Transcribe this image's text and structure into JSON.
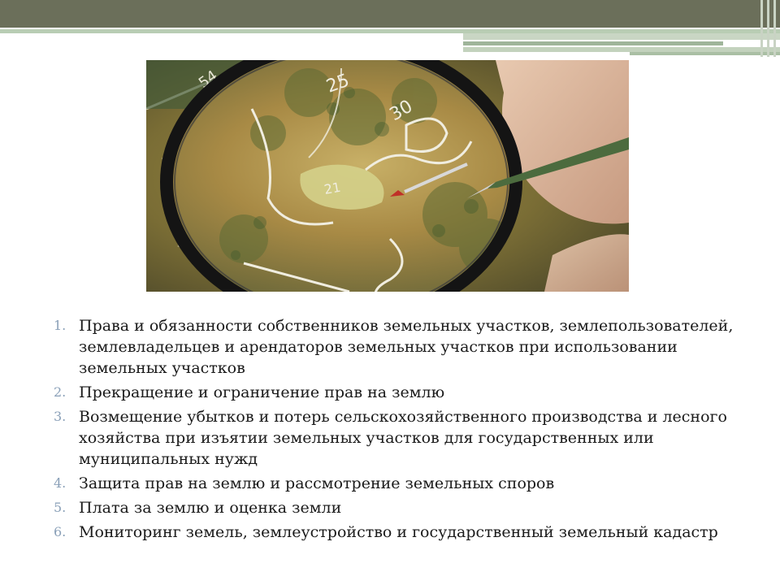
{
  "slide": {
    "image_alt": "magnifying-glass-over-land-map",
    "items": [
      {
        "num": "1.",
        "text": "Права и обязанности собственников земельных участков, землепользователей, землевладельцев и арендаторов земельных участков при использовании земельных участков"
      },
      {
        "num": "2.",
        "text": "Прекращение и ограничение прав на землю"
      },
      {
        "num": "3.",
        "text": "Возмещение убытков и потерь сельскохозяйственного производства и лесного хозяйства при изъятии земельных участков для государственных или муниципальных нужд"
      },
      {
        "num": "4.",
        "text": "Защита прав на землю и рассмотрение земельных споров"
      },
      {
        "num": "5.",
        "text": "Плата за землю и оценка земли"
      },
      {
        "num": "6.",
        "text": "Мониторинг земель, землеустройство и государственный земельный кадастр"
      }
    ]
  },
  "map_labels": {
    "label_a": "25",
    "label_b": "30",
    "label_c": "21",
    "label_d": "54"
  },
  "colors": {
    "header_band": "#6b6f5a",
    "accent_green": "#b9cdb4",
    "list_number": "#8aa0b8"
  }
}
